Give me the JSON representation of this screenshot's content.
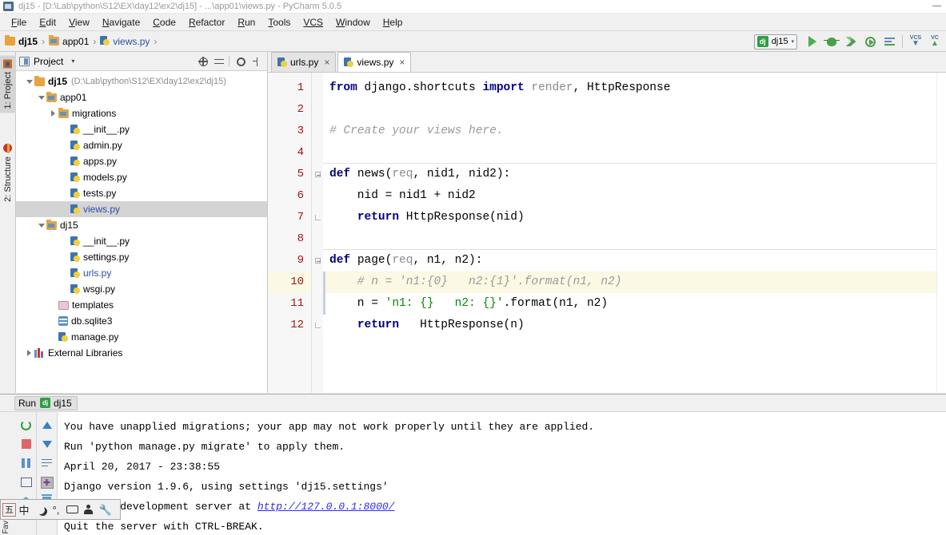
{
  "window": {
    "title": "dj15 - [D:\\Lab\\python\\S12\\EX\\day12\\ex2\\dj15] - ...\\app01\\views.py - PyCharm 5.0.5",
    "app_icon": "pycharm-icon",
    "minimize_label": "–"
  },
  "menubar": {
    "items": [
      {
        "pre": "F",
        "rest": "ile"
      },
      {
        "pre": "E",
        "rest": "dit"
      },
      {
        "pre": "V",
        "rest": "iew"
      },
      {
        "pre": "N",
        "rest": "avigate"
      },
      {
        "pre": "C",
        "rest": "ode"
      },
      {
        "pre": "R",
        "rest": "efactor"
      },
      {
        "pre": "R",
        "rest": "un"
      },
      {
        "pre": "T",
        "rest": "ools"
      },
      {
        "pre": "VCS",
        "rest": ""
      },
      {
        "pre": "W",
        "rest": "indow"
      },
      {
        "pre": "H",
        "rest": "elp"
      }
    ]
  },
  "breadcrumb": {
    "items": [
      {
        "label": "dj15",
        "icon": "folder-icon",
        "bold": true,
        "link": false
      },
      {
        "label": "app01",
        "icon": "folder-module-icon",
        "bold": false,
        "link": false
      },
      {
        "label": "views.py",
        "icon": "python-file-icon",
        "bold": false,
        "link": true
      }
    ],
    "separator": "›"
  },
  "toolbar": {
    "run_config": {
      "name": "dj15",
      "badge": "dj",
      "caret": "▾"
    },
    "buttons": [
      {
        "name": "run-button",
        "icon": "run-triangle-icon"
      },
      {
        "name": "debug-button",
        "icon": "debug-bug-icon"
      },
      {
        "name": "run-coverage-button",
        "icon": "coverage-icon"
      },
      {
        "name": "run-with-profiler-button",
        "icon": "profiler-icon"
      },
      {
        "name": "attach-button",
        "icon": "attach-lines-icon"
      }
    ],
    "vcs": [
      {
        "label": "VCS",
        "icon": "vcs-update-icon"
      },
      {
        "label": "VC",
        "icon": "vcs-commit-icon"
      }
    ]
  },
  "left_tool_tabs": [
    {
      "label": "1: Project",
      "icon": "project-icon",
      "selected": true
    },
    {
      "label": "2: Structure",
      "icon": "structure-icon",
      "selected": false
    }
  ],
  "project_panel": {
    "header": {
      "title": "Project",
      "caret": "▾",
      "actions": [
        {
          "name": "scroll-from-source-button",
          "icon": "target-icon"
        },
        {
          "name": "collapse-all-button",
          "icon": "collapse-all-icon"
        },
        {
          "name": "settings-button",
          "icon": "gear-icon"
        },
        {
          "name": "hide-button",
          "icon": "hide-panel-icon"
        }
      ]
    },
    "tree": [
      {
        "indent": 0,
        "arrow": "down",
        "icon": "folder-icon",
        "label": "dj15",
        "bold": true,
        "link": false,
        "path": "(D:\\Lab\\python\\S12\\EX\\day12\\ex2\\dj15)",
        "selected": false
      },
      {
        "indent": 1,
        "arrow": "down",
        "icon": "folder-module-icon",
        "label": "app01",
        "bold": false,
        "link": false,
        "path": "",
        "selected": false
      },
      {
        "indent": 2,
        "arrow": "right",
        "icon": "folder-module-icon",
        "label": "migrations",
        "bold": false,
        "link": false,
        "path": "",
        "selected": false
      },
      {
        "indent": 3,
        "arrow": "none",
        "icon": "python-file-icon",
        "label": "__init__.py",
        "bold": false,
        "link": false,
        "path": "",
        "selected": false
      },
      {
        "indent": 3,
        "arrow": "none",
        "icon": "python-file-icon",
        "label": "admin.py",
        "bold": false,
        "link": false,
        "path": "",
        "selected": false
      },
      {
        "indent": 3,
        "arrow": "none",
        "icon": "python-file-icon",
        "label": "apps.py",
        "bold": false,
        "link": false,
        "path": "",
        "selected": false
      },
      {
        "indent": 3,
        "arrow": "none",
        "icon": "python-file-icon",
        "label": "models.py",
        "bold": false,
        "link": false,
        "path": "",
        "selected": false
      },
      {
        "indent": 3,
        "arrow": "none",
        "icon": "python-file-icon",
        "label": "tests.py",
        "bold": false,
        "link": false,
        "path": "",
        "selected": false
      },
      {
        "indent": 3,
        "arrow": "none",
        "icon": "python-file-icon",
        "label": "views.py",
        "bold": false,
        "link": true,
        "path": "",
        "selected": true
      },
      {
        "indent": 1,
        "arrow": "down",
        "icon": "folder-module-icon",
        "label": "dj15",
        "bold": false,
        "link": false,
        "path": "",
        "selected": false
      },
      {
        "indent": 3,
        "arrow": "none",
        "icon": "python-file-icon",
        "label": "__init__.py",
        "bold": false,
        "link": false,
        "path": "",
        "selected": false
      },
      {
        "indent": 3,
        "arrow": "none",
        "icon": "python-file-icon",
        "label": "settings.py",
        "bold": false,
        "link": false,
        "path": "",
        "selected": false
      },
      {
        "indent": 3,
        "arrow": "none",
        "icon": "python-file-icon",
        "label": "urls.py",
        "bold": false,
        "link": true,
        "path": "",
        "selected": false
      },
      {
        "indent": 3,
        "arrow": "none",
        "icon": "python-file-icon",
        "label": "wsgi.py",
        "bold": false,
        "link": false,
        "path": "",
        "selected": false
      },
      {
        "indent": 2,
        "arrow": "none",
        "icon": "folder-templates-icon",
        "label": "templates",
        "bold": false,
        "link": false,
        "path": "",
        "selected": false
      },
      {
        "indent": 2,
        "arrow": "none",
        "icon": "database-file-icon",
        "label": "db.sqlite3",
        "bold": false,
        "link": false,
        "path": "",
        "selected": false
      },
      {
        "indent": 2,
        "arrow": "none",
        "icon": "python-file-icon",
        "label": "manage.py",
        "bold": false,
        "link": false,
        "path": "",
        "selected": false
      },
      {
        "indent": 0,
        "arrow": "right",
        "icon": "libraries-icon",
        "label": "External Libraries",
        "bold": false,
        "link": false,
        "path": "",
        "selected": false
      }
    ]
  },
  "editor": {
    "tabs": [
      {
        "label": "urls.py",
        "icon": "python-file-icon",
        "active": false,
        "close": "×"
      },
      {
        "label": "views.py",
        "icon": "python-file-icon",
        "active": true,
        "close": "×"
      }
    ],
    "lines": [
      {
        "n": "1",
        "fold": "none",
        "highlight": false,
        "tokens": [
          {
            "t": "from ",
            "c": "kw"
          },
          {
            "t": "django.shortcuts ",
            "c": "plain"
          },
          {
            "t": "import ",
            "c": "kw"
          },
          {
            "t": "render",
            "c": "param"
          },
          {
            "t": ", HttpResponse",
            "c": "plain"
          }
        ]
      },
      {
        "n": "2",
        "fold": "none",
        "highlight": false,
        "tokens": []
      },
      {
        "n": "3",
        "fold": "none",
        "highlight": false,
        "tokens": [
          {
            "t": "# Create your views here.",
            "c": "cmt"
          }
        ]
      },
      {
        "n": "4",
        "fold": "none",
        "highlight": false,
        "tokens": []
      },
      {
        "n": "5",
        "fold": "minus",
        "highlight": false,
        "tokens": [
          {
            "t": "def ",
            "c": "kw"
          },
          {
            "t": "news",
            "c": "plain"
          },
          {
            "t": "(",
            "c": "plain"
          },
          {
            "t": "req",
            "c": "param"
          },
          {
            "t": ", nid1, nid2):",
            "c": "plain"
          }
        ]
      },
      {
        "n": "6",
        "fold": "none",
        "highlight": false,
        "tokens": [
          {
            "t": "    nid = nid1 + nid2",
            "c": "plain"
          }
        ]
      },
      {
        "n": "7",
        "fold": "end",
        "highlight": false,
        "tokens": [
          {
            "t": "    ",
            "c": "plain"
          },
          {
            "t": "return ",
            "c": "kw"
          },
          {
            "t": "HttpResponse(nid)",
            "c": "plain"
          }
        ]
      },
      {
        "n": "8",
        "fold": "none",
        "highlight": false,
        "tokens": []
      },
      {
        "n": "9",
        "fold": "minus",
        "highlight": false,
        "tokens": [
          {
            "t": "def ",
            "c": "kw"
          },
          {
            "t": "page",
            "c": "plain"
          },
          {
            "t": "(",
            "c": "plain"
          },
          {
            "t": "req",
            "c": "param"
          },
          {
            "t": ", n1, n2):",
            "c": "plain"
          }
        ]
      },
      {
        "n": "10",
        "fold": "none",
        "highlight": true,
        "tokens": [
          {
            "t": "    # n = 'n1:{0}   n2:{1}'.format(n1, n2)",
            "c": "cmt"
          }
        ]
      },
      {
        "n": "11",
        "fold": "none",
        "highlight": false,
        "tokens": [
          {
            "t": "    n = ",
            "c": "plain"
          },
          {
            "t": "'n1: {}   n2: {}'",
            "c": "str"
          },
          {
            "t": ".format(n1, n2)",
            "c": "plain"
          }
        ]
      },
      {
        "n": "12",
        "fold": "end",
        "highlight": false,
        "tokens": [
          {
            "t": "    ",
            "c": "plain"
          },
          {
            "t": "return ",
            "c": "kw"
          },
          {
            "t": "  HttpResponse(n)",
            "c": "plain"
          }
        ]
      }
    ]
  },
  "run_panel": {
    "header": {
      "label": "Run",
      "badge": "dj",
      "config_name": "dj15"
    },
    "left_buttons": [
      {
        "name": "rerun-button",
        "icon": "rerun-icon"
      },
      {
        "name": "stop-button",
        "icon": "stop-icon"
      },
      {
        "name": "pause-button",
        "icon": "pause-icon"
      },
      {
        "name": "print-button",
        "icon": "print-icon"
      },
      {
        "name": "pin-tab-button",
        "icon": "pin-icon"
      }
    ],
    "right_buttons": [
      {
        "name": "scroll-up-button",
        "icon": "arrow-up-icon"
      },
      {
        "name": "scroll-down-button",
        "icon": "arrow-down-icon"
      },
      {
        "name": "soft-wrap-button",
        "icon": "soft-wrap-icon"
      },
      {
        "name": "print-console-button",
        "icon": "console-print-icon"
      },
      {
        "name": "clear-all-button",
        "icon": "trash-icon"
      }
    ],
    "console_lines": [
      {
        "text": "You have unapplied migrations; your app may not work properly until they are applied.",
        "link": null
      },
      {
        "text": "Run 'python manage.py migrate' to apply them.",
        "link": null
      },
      {
        "text": "April 20, 2017 - 23:38:55",
        "link": null
      },
      {
        "text": "Django version 1.9.6, using settings 'dj15.settings'",
        "link": null
      },
      {
        "text": "Starting development server at ",
        "link": "http://127.0.0.1:8000/"
      },
      {
        "text": "Quit the server with CTRL-BREAK.",
        "link": null
      }
    ]
  },
  "ime_bar": {
    "items": [
      {
        "name": "ime-mode-indicator",
        "glyph": "五",
        "boxed": true
      },
      {
        "name": "ime-chinese-toggle",
        "glyph": "中",
        "boxed": false
      },
      {
        "name": "ime-halfwidth-toggle",
        "glyph": "moon-icon",
        "boxed": false
      },
      {
        "name": "ime-punctuation-toggle",
        "glyph": "°,",
        "boxed": false
      },
      {
        "name": "ime-softkeyboard-button",
        "glyph": "keyboard-icon",
        "boxed": false
      },
      {
        "name": "ime-handwriting-button",
        "glyph": "person-icon",
        "boxed": false
      },
      {
        "name": "ime-settings-button",
        "glyph": "wrench-icon",
        "boxed": false
      }
    ]
  },
  "colors": {
    "accent_green": "#2f9e44",
    "keyword_blue": "#000080",
    "string_green": "#058b00",
    "comment_gray": "#9a9a9a",
    "linenum_red": "#a0160e",
    "highlight_line": "#fbf8e4",
    "link_blue": "#2a4fa0",
    "selection_gray": "#d4d4d4"
  }
}
